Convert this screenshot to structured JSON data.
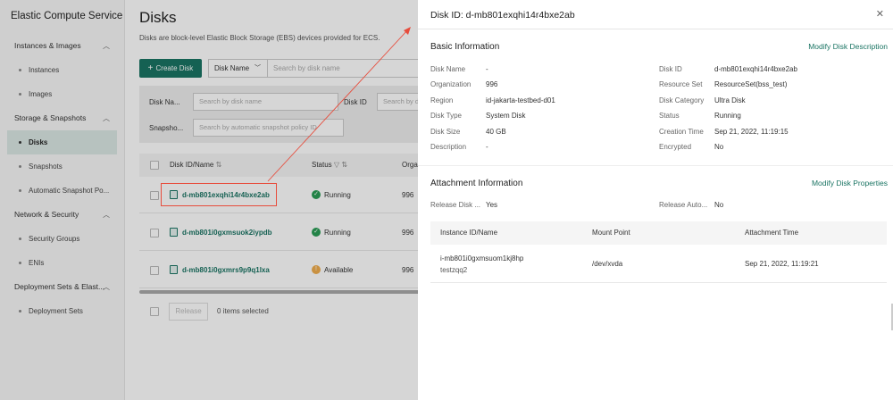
{
  "app": {
    "title": "Elastic Compute Service"
  },
  "sidebar": {
    "groups": [
      {
        "label": "Instances & Images",
        "items": [
          "Instances",
          "Images"
        ]
      },
      {
        "label": "Storage & Snapshots",
        "items": [
          "Disks",
          "Snapshots",
          "Automatic Snapshot Po..."
        ]
      },
      {
        "label": "Network & Security",
        "items": [
          "Security Groups",
          "ENIs"
        ]
      },
      {
        "label": "Deployment Sets & Elast...",
        "items": [
          "Deployment Sets"
        ]
      }
    ],
    "active_item": "Disks"
  },
  "main": {
    "title": "Disks",
    "description": "Disks are block-level Elastic Block Storage (EBS) devices provided for ECS.",
    "create_button": "Create Disk",
    "search_field_select": "Disk Name",
    "search_placeholder": "Search by disk name",
    "filters": {
      "disk_name_label": "Disk Na...",
      "disk_name_placeholder": "Search by disk name",
      "disk_id_label": "Disk ID",
      "disk_id_placeholder": "Search by di",
      "snapshot_label": "Snapsho...",
      "snapshot_placeholder": "Search by automatic snapshot policy ID"
    },
    "table": {
      "columns": [
        "Disk ID/Name",
        "Status",
        "Orga"
      ],
      "rows": [
        {
          "id": "d-mb801exqhi14r4bxe2ab",
          "status": "Running",
          "org": "996"
        },
        {
          "id": "d-mb801i0gxmsuok2iypdb",
          "status": "Running",
          "org": "996"
        },
        {
          "id": "d-mb801i0gxmrs9p9q1lxa",
          "status": "Available",
          "org": "996"
        }
      ]
    },
    "release_button": "Release",
    "selected_text": "0 items selected"
  },
  "drawer": {
    "title": "Disk ID: d-mb801exqhi14r4bxe2ab",
    "basic_info": {
      "title": "Basic Information",
      "action": "Modify Disk Description",
      "left": [
        {
          "label": "Disk Name",
          "value": "-"
        },
        {
          "label": "Organization",
          "value": "996"
        },
        {
          "label": "Region",
          "value": "id-jakarta-testbed-d01"
        },
        {
          "label": "Disk Type",
          "value": "System Disk"
        },
        {
          "label": "Disk Size",
          "value": "40 GB"
        },
        {
          "label": "Description",
          "value": "-"
        }
      ],
      "right": [
        {
          "label": "Disk ID",
          "value": "d-mb801exqhi14r4bxe2ab"
        },
        {
          "label": "Resource Set",
          "value": "ResourceSet(bss_test)"
        },
        {
          "label": "Disk Category",
          "value": "Ultra Disk"
        },
        {
          "label": "Status",
          "value": "Running"
        },
        {
          "label": "Creation Time",
          "value": "Sep 21, 2022, 11:19:15"
        },
        {
          "label": "Encrypted",
          "value": "No"
        }
      ]
    },
    "attachment_info": {
      "title": "Attachment Information",
      "action": "Modify Disk Properties",
      "release_disk_label": "Release Disk ...",
      "release_disk_value": "Yes",
      "release_auto_label": "Release Auto...",
      "release_auto_value": "No",
      "columns": [
        "Instance ID/Name",
        "Mount Point",
        "Attachment Time"
      ],
      "row": {
        "instance_id": "i-mb801i0gxmsuom1kj8hp",
        "instance_name": "testzqq2",
        "mount_point": "/dev/xvda",
        "attachment_time": "Sep 21, 2022, 11:19:21"
      }
    }
  },
  "colors": {
    "accent": "#1a7463",
    "running": "#2a9d55",
    "available": "#f0ad4e",
    "annotation": "#e74c3c"
  }
}
